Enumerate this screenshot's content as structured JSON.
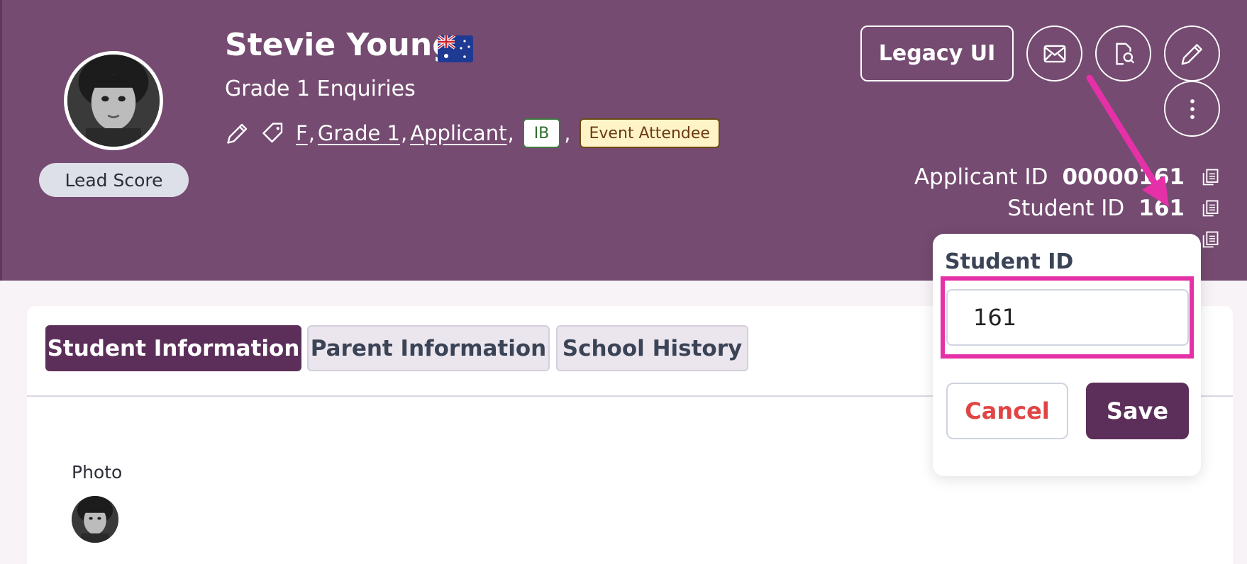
{
  "profile": {
    "name": "Stevie Young",
    "subtitle": "Grade 1 Enquiries",
    "lead_score_label": "Lead Score",
    "flag_icon": "australia-flag-icon"
  },
  "tags": {
    "links": [
      "F",
      "Grade 1",
      "Applicant"
    ],
    "separator": ",",
    "badge_ib": "IB",
    "badge_event": "Event Attendee"
  },
  "header_actions": {
    "legacy_label": "Legacy UI",
    "icons": [
      "mail-icon",
      "document-search-icon",
      "pencil-icon",
      "more-vertical-icon"
    ]
  },
  "ids": {
    "applicant_label": "Applicant ID",
    "applicant_value": "00000161",
    "student_label": "Student ID",
    "student_value": "161"
  },
  "tabs": [
    {
      "label": "Student Information",
      "active": true
    },
    {
      "label": "Parent Information",
      "active": false
    },
    {
      "label": "School History",
      "active": false
    }
  ],
  "content": {
    "photo_label": "Photo"
  },
  "popover": {
    "title": "Student ID",
    "input_value": "161",
    "cancel_label": "Cancel",
    "save_label": "Save"
  },
  "colors": {
    "header_bg": "#754b71",
    "primary": "#5c2f5a",
    "highlight": "#e530a8",
    "cancel_text": "#e04545"
  }
}
